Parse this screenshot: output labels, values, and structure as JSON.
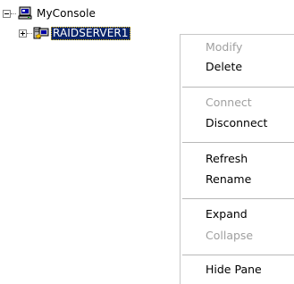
{
  "tree": {
    "root": {
      "label": "MyConsole",
      "icon": "console-computer-icon",
      "expander": "collapse-minus"
    },
    "child": {
      "label": "RAIDSERVER1",
      "icon": "server-computer-icon",
      "expander": "expand-plus",
      "selected": true
    }
  },
  "context_menu": {
    "items": [
      {
        "label": "Modify",
        "enabled": false
      },
      {
        "label": "Delete",
        "enabled": true
      },
      {
        "label": "Connect",
        "enabled": false
      },
      {
        "label": "Disconnect",
        "enabled": true
      },
      {
        "label": "Refresh",
        "enabled": true
      },
      {
        "label": "Rename",
        "enabled": true
      },
      {
        "label": "Expand",
        "enabled": true
      },
      {
        "label": "Collapse",
        "enabled": false
      },
      {
        "label": "Hide Pane",
        "enabled": true
      }
    ]
  },
  "colors": {
    "selection_bg": "#0a246a",
    "selection_text": "#ffffff",
    "disabled_text": "#a0a0a0"
  }
}
